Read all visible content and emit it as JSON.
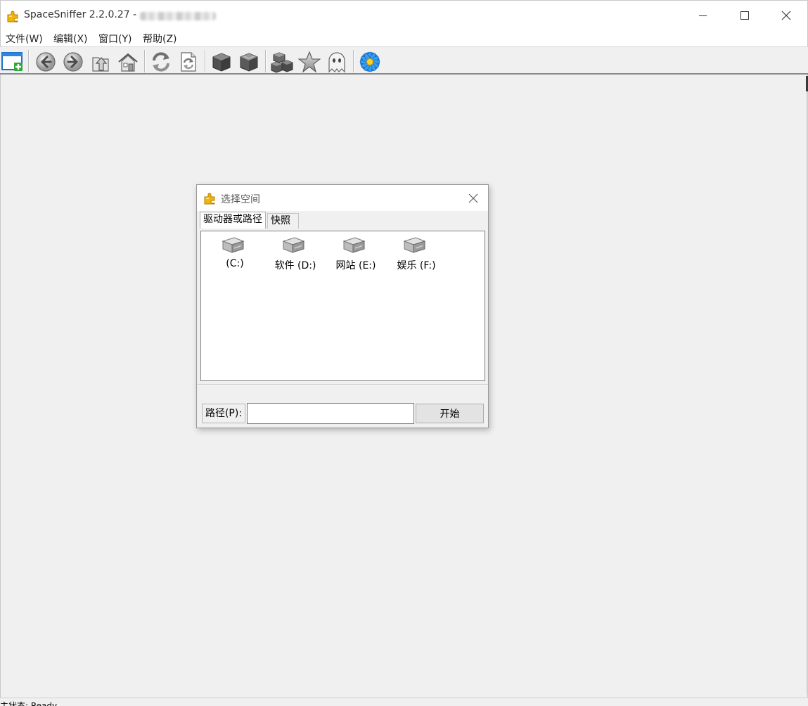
{
  "window": {
    "title": "SpaceSniffer 2.2.0.27 - "
  },
  "menu": {
    "items": [
      {
        "label": "文件(W)"
      },
      {
        "label": "编辑(X)"
      },
      {
        "label": "窗口(Y)"
      },
      {
        "label": "帮助(Z)"
      }
    ]
  },
  "toolbar": {
    "icons": [
      "new-window-icon",
      "back-icon",
      "forward-icon",
      "up-folder-icon",
      "home-icon",
      "refresh-icon",
      "rescan-icon",
      "zoom-in-cube-icon",
      "zoom-out-cube-icon",
      "tags-cubes-icon",
      "favorite-star-icon",
      "ghost-icon",
      "settings-flower-icon"
    ]
  },
  "status": {
    "text": "主状态: Ready"
  },
  "dialog": {
    "title": "选择空间",
    "tabs": [
      {
        "label": "驱动器或路径",
        "active": true
      },
      {
        "label": "快照",
        "active": false
      }
    ],
    "drives": [
      {
        "label": "(C:)"
      },
      {
        "label": "软件 (D:)"
      },
      {
        "label": "网站 (E:)"
      },
      {
        "label": "娱乐 (F:)"
      }
    ],
    "path_label": "路径(P):",
    "path_value": "",
    "start_label": "开始"
  },
  "colors": {
    "background": "#f0f0f0",
    "panel": "#ffffff",
    "accent_blue": "#1e7fd8",
    "puzzle_yellow": "#f2b705"
  }
}
